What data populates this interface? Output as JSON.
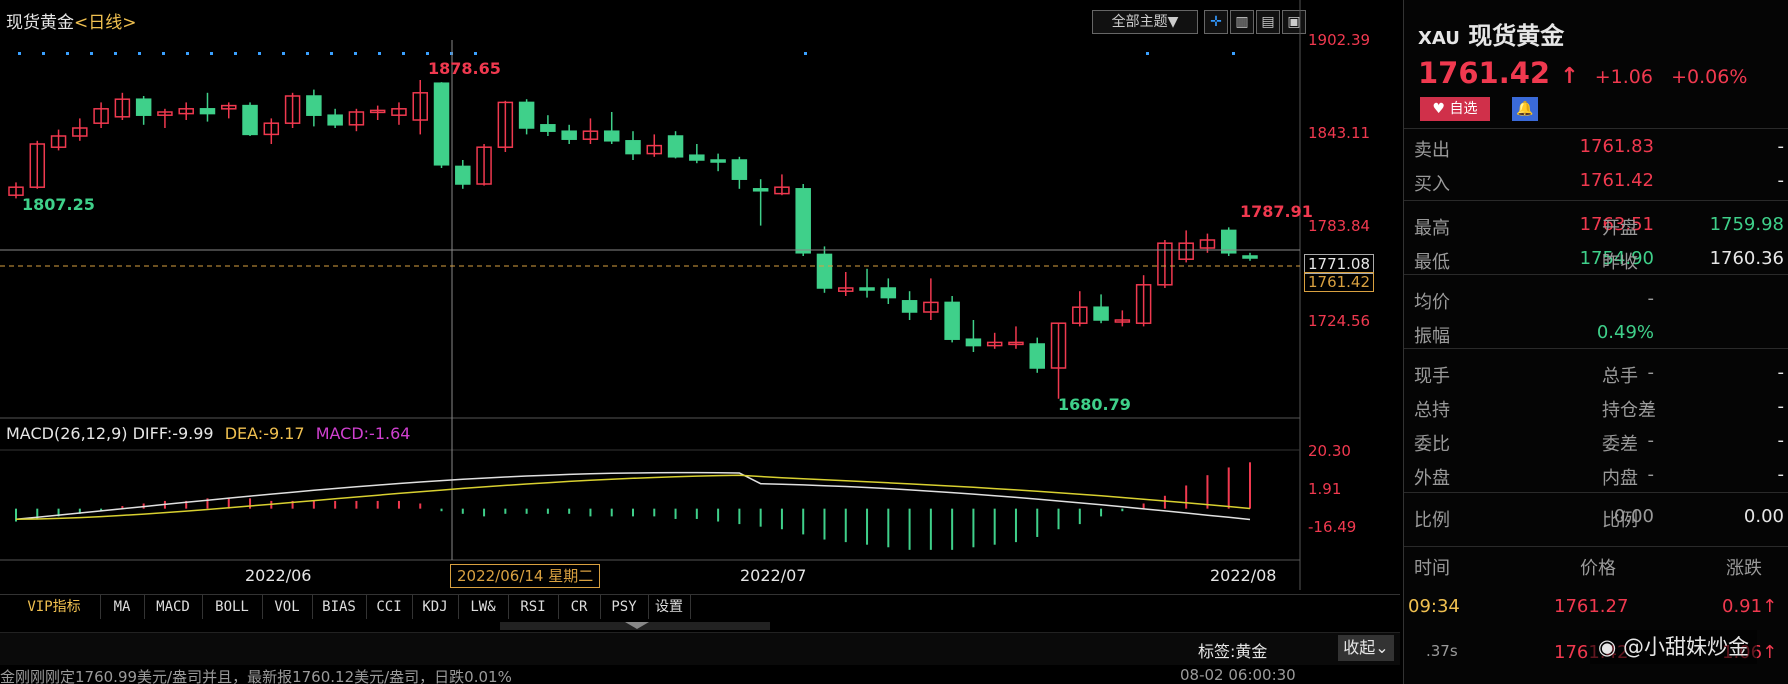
{
  "chart": {
    "title": "现货黄金",
    "period": "<日线>",
    "theme_button": "全部主题▼",
    "y_labels": [
      "1902.39",
      "1843.11",
      "1783.84",
      "1724.56"
    ],
    "crosshair_value": "1771.08",
    "last_price_tag": "1761.42",
    "annotations": {
      "high_left": "1878.65",
      "low_left": "1807.25",
      "recent_high": "1787.91",
      "low": "1680.79"
    },
    "macd_header": {
      "name": "MACD(26,12,9)",
      "diff": "DIFF:-9.99",
      "dea": "DEA:-9.17",
      "macd": "MACD:-1.64"
    },
    "macd_labels": [
      "20.30",
      "1.91",
      "-16.49"
    ],
    "x_labels": [
      "2022/06",
      "2022/07",
      "2022/08"
    ],
    "crosshair_date": "2022/06/14 星期二",
    "tabs": [
      "VIP指标",
      "MA",
      "MACD",
      "BOLL",
      "VOL",
      "BIAS",
      "CCI",
      "KDJ",
      "LW&",
      "RSI",
      "CR",
      "PSY",
      "设置"
    ],
    "tag_label": "标签:黄金",
    "collapse_label": "收起",
    "news_ticker": "金刚刚刚定1760.99美元/盎司并且，最新报1760.12美元/盎司，日跌0.01%",
    "news_time": "08-02 06:00:30"
  },
  "chart_data": {
    "type": "candlestick",
    "candles": [
      [
        1808,
        1813,
        1806,
        1816
      ],
      [
        1813,
        1840,
        1812,
        1842
      ],
      [
        1838,
        1845,
        1836,
        1849
      ],
      [
        1845,
        1850,
        1842,
        1856
      ],
      [
        1853,
        1862,
        1850,
        1866
      ],
      [
        1857,
        1868,
        1855,
        1872
      ],
      [
        1868,
        1858,
        1852,
        1870
      ],
      [
        1858,
        1860,
        1850,
        1862
      ],
      [
        1859,
        1862,
        1855,
        1866
      ],
      [
        1862,
        1859,
        1854,
        1872
      ],
      [
        1862,
        1864,
        1856,
        1866
      ],
      [
        1864,
        1846,
        1845,
        1866
      ],
      [
        1846,
        1853,
        1840,
        1856
      ],
      [
        1853,
        1870,
        1850,
        1872
      ],
      [
        1870,
        1858,
        1851,
        1874
      ],
      [
        1858,
        1852,
        1850,
        1862
      ],
      [
        1852,
        1860,
        1848,
        1862
      ],
      [
        1860,
        1861,
        1855,
        1864
      ],
      [
        1858,
        1862,
        1852,
        1866
      ],
      [
        1855,
        1872,
        1846,
        1880
      ],
      [
        1878,
        1827,
        1825,
        1878.65
      ],
      [
        1826,
        1815,
        1812,
        1830
      ],
      [
        1815,
        1838,
        1814,
        1840
      ],
      [
        1838,
        1866,
        1835,
        1867
      ],
      [
        1866,
        1850,
        1846,
        1868
      ],
      [
        1852,
        1848,
        1845,
        1858
      ],
      [
        1848,
        1843,
        1840,
        1852
      ],
      [
        1843,
        1848,
        1840,
        1856
      ],
      [
        1848,
        1842,
        1840,
        1860
      ],
      [
        1842,
        1834,
        1830,
        1848
      ],
      [
        1834,
        1839,
        1832,
        1846
      ],
      [
        1845,
        1832,
        1831,
        1848
      ],
      [
        1833,
        1830,
        1828,
        1840
      ],
      [
        1830,
        1829,
        1823,
        1834
      ],
      [
        1830,
        1818,
        1812,
        1832
      ],
      [
        1812,
        1811,
        1789,
        1818
      ],
      [
        1809,
        1813,
        1808,
        1821
      ],
      [
        1812,
        1772,
        1770,
        1815
      ],
      [
        1771,
        1750,
        1747,
        1776
      ],
      [
        1748,
        1750,
        1745,
        1760
      ],
      [
        1750,
        1749,
        1744,
        1762
      ],
      [
        1750,
        1744,
        1740,
        1756
      ],
      [
        1742,
        1735,
        1730,
        1748
      ],
      [
        1735,
        1741,
        1730,
        1756
      ],
      [
        1741,
        1718,
        1716,
        1745
      ],
      [
        1718,
        1714,
        1710,
        1730
      ],
      [
        1714,
        1716,
        1712,
        1722
      ],
      [
        1716,
        1716,
        1712,
        1726
      ],
      [
        1715,
        1700,
        1697,
        1719
      ],
      [
        1700,
        1728,
        1680.79,
        1728
      ],
      [
        1728,
        1738,
        1726,
        1748
      ],
      [
        1738,
        1730,
        1728,
        1746
      ],
      [
        1729,
        1730,
        1726,
        1736
      ],
      [
        1728,
        1752,
        1726,
        1758
      ],
      [
        1752,
        1778,
        1750,
        1780
      ],
      [
        1768,
        1778,
        1766,
        1786
      ],
      [
        1775,
        1780,
        1772,
        1784
      ],
      [
        1786,
        1772,
        1770,
        1787.91
      ],
      [
        1770,
        1769,
        1767,
        1772
      ]
    ],
    "candle_format": [
      "open",
      "close",
      "low",
      "high"
    ],
    "ylim": [
      1680,
      1905
    ],
    "macd": {
      "hist": [
        -5,
        -4,
        -3,
        -2,
        -1,
        1,
        2,
        3,
        3,
        4,
        4,
        4,
        3,
        3,
        3,
        3,
        3,
        3,
        3,
        2,
        -1,
        -2,
        -3,
        -2,
        -2,
        -2,
        -2,
        -3,
        -3,
        -3,
        -3,
        -4,
        -4,
        -5,
        -6,
        -7,
        -8,
        -10,
        -12,
        -13,
        -14,
        -15,
        -16,
        -16,
        -16,
        -15,
        -14,
        -13,
        -11,
        -8,
        -6,
        -3,
        -1,
        2,
        5,
        9,
        13,
        16,
        18
      ],
      "ylim": [
        -18,
        22
      ]
    }
  },
  "quote": {
    "symbol": "XAU",
    "name": "现货黄金",
    "price": "1761.42",
    "arrow": "↑",
    "change": "+1.06",
    "change_pct": "+0.06%",
    "fav_label": "自选",
    "rows": [
      {
        "l1": "卖出",
        "v1": "1761.83",
        "l2": "",
        "v2": "-"
      },
      {
        "l1": "买入",
        "v1": "1761.42",
        "l2": "",
        "v2": "-"
      },
      {
        "l1": "最高",
        "v1": "1763.51",
        "l2": "开盘",
        "v2": "1759.98"
      },
      {
        "l1": "最低",
        "v1": "1754.90",
        "l2": "昨收",
        "v2": "1760.36"
      },
      {
        "l1": "均价",
        "v1": "-",
        "l2": "",
        "v2": ""
      },
      {
        "l1": "振幅",
        "v1": "0.49%",
        "l2": "",
        "v2": ""
      },
      {
        "l1": "现手",
        "v1": "-",
        "l2": "总手",
        "v2": "-"
      },
      {
        "l1": "总持",
        "v1": "-",
        "l2": "持仓差",
        "v2": "-"
      },
      {
        "l1": "委比",
        "v1": "-",
        "l2": "委差",
        "v2": "-"
      },
      {
        "l1": "外盘",
        "v1": "-",
        "l2": "内盘",
        "v2": "-"
      },
      {
        "l1": "比例",
        "v1": "0.00",
        "l2": "比例",
        "v2": "0.00"
      }
    ],
    "trades_header": {
      "time": "时间",
      "price": "价格",
      "change": "涨跌"
    },
    "trades": [
      {
        "time": "09:34",
        "price": "1761.27",
        "change": "0.91↑"
      },
      {
        "time": ".37s",
        "price": "1761.42",
        "change": "1.06↑"
      }
    ],
    "watermark": "@小甜妹炒金"
  },
  "colors": {
    "up": "#f0394f",
    "down": "#3fd08a",
    "bg": "#000000",
    "accent": "#f0c050"
  }
}
